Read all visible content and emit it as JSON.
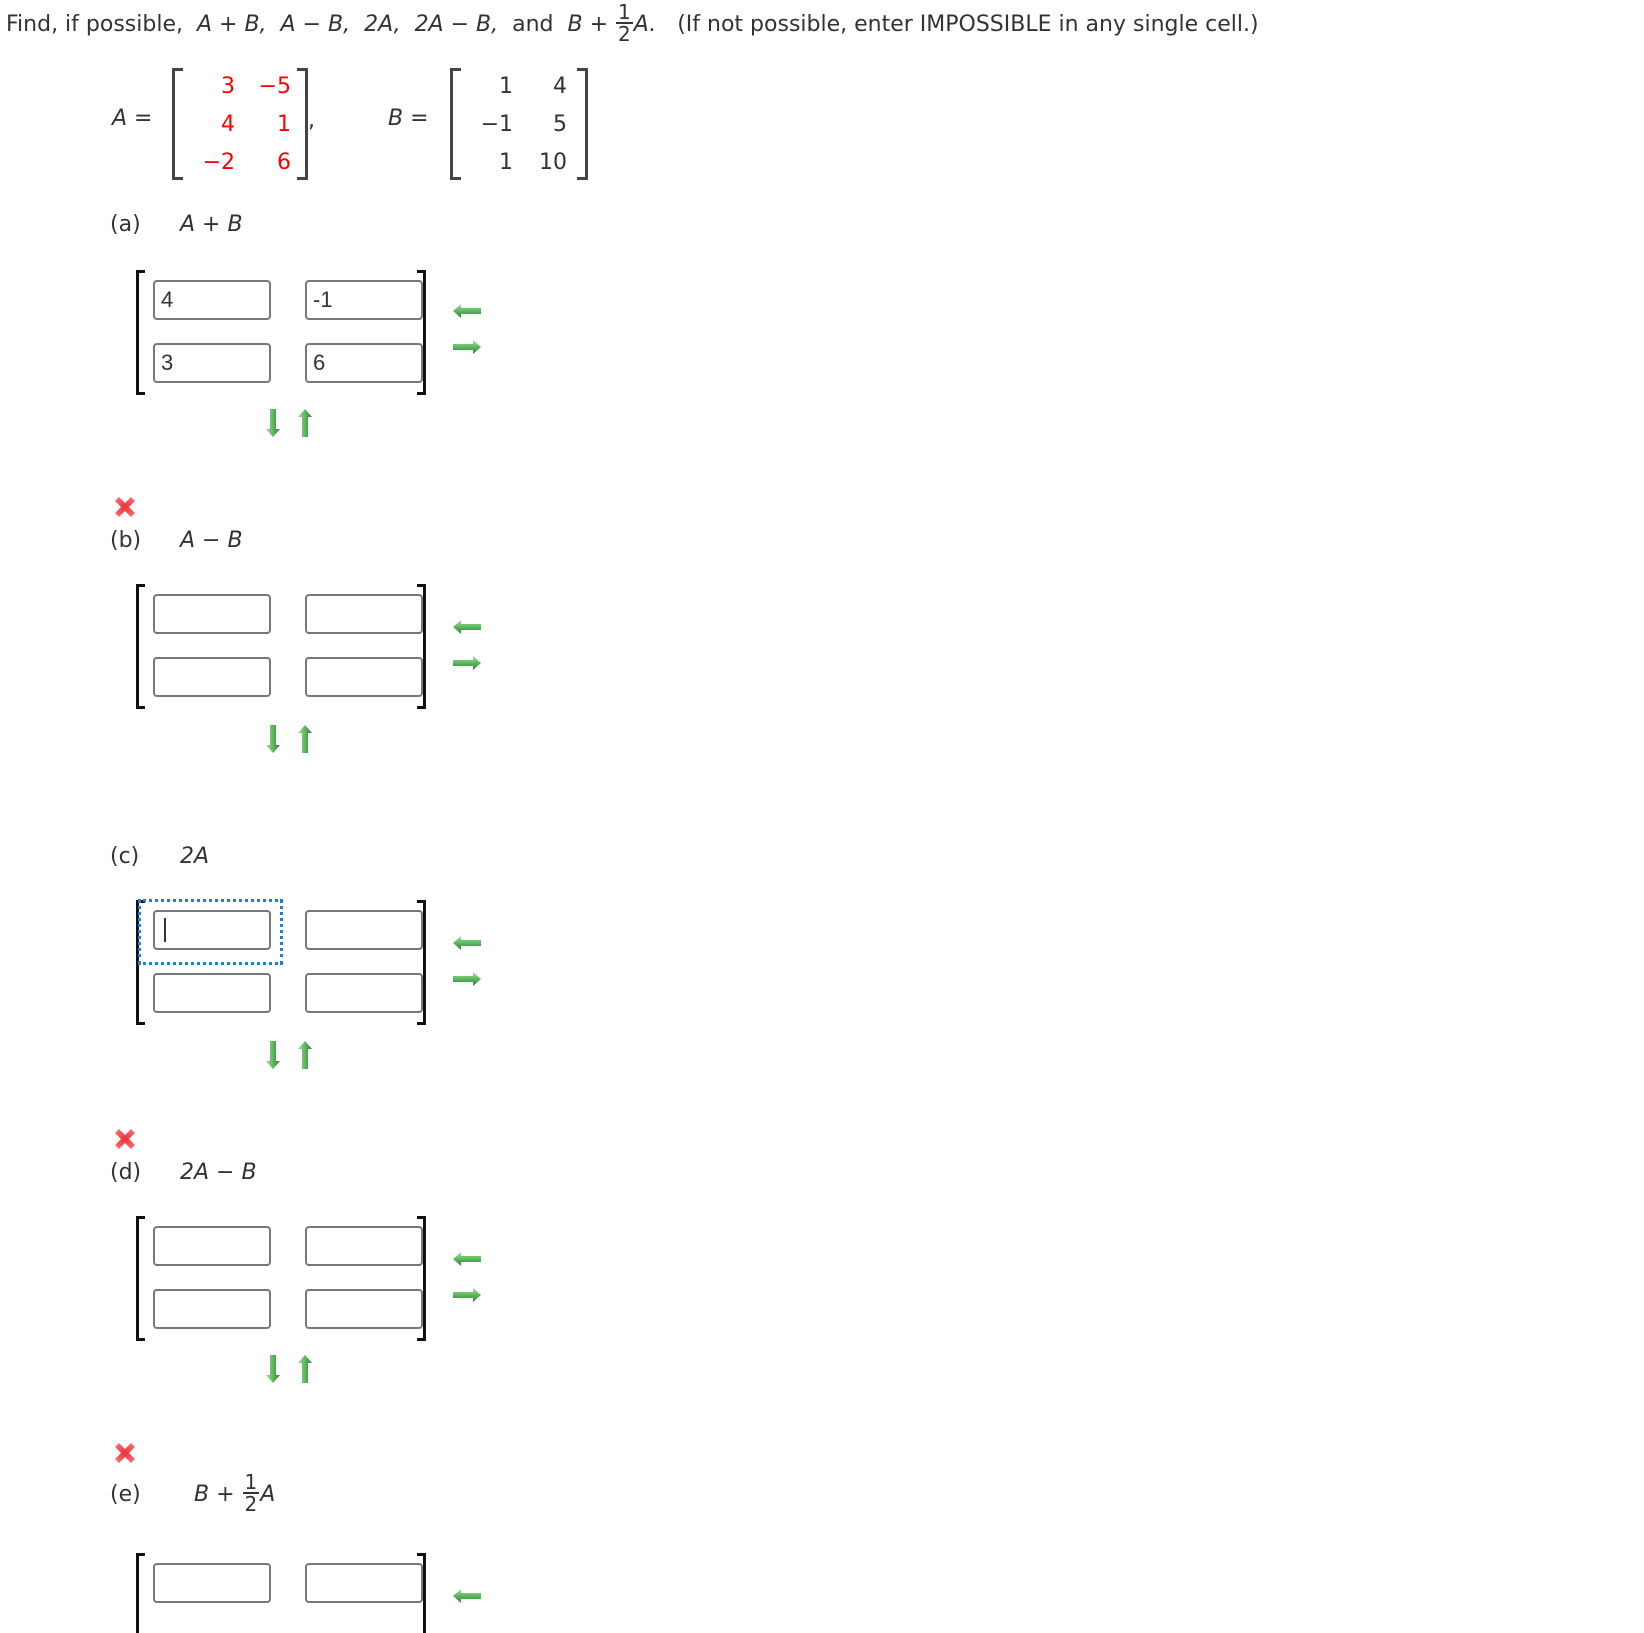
{
  "question": {
    "prefix": "Find, if possible,",
    "expr1": "A + B,",
    "expr2": "A − B,",
    "expr3": "2A,",
    "expr4": "2A − B,",
    "and": "and",
    "expr5_pre": "B +",
    "frac_num": "1",
    "frac_den": "2",
    "expr5_post": "A.",
    "note": "(If not possible, enter IMPOSSIBLE in any single cell.)"
  },
  "given": {
    "A_label": "A =",
    "B_label": "B =",
    "comma": ",",
    "A": [
      [
        "3",
        "−5"
      ],
      [
        "4",
        "1"
      ],
      [
        "−2",
        "6"
      ]
    ],
    "B": [
      [
        "1",
        "4"
      ],
      [
        "−1",
        "5"
      ],
      [
        "1",
        "10"
      ]
    ],
    "A_color": "#ff0000",
    "B_color": "#333333"
  },
  "parts": [
    {
      "letter": "(a)",
      "expression": "A + B",
      "status": "none",
      "cells": [
        [
          "4",
          "-1"
        ],
        [
          "3",
          "6"
        ]
      ],
      "focused_cell": null
    },
    {
      "letter": "(b)",
      "expression": "A − B",
      "status": "incorrect",
      "cells": [
        [
          "",
          ""
        ],
        [
          "",
          ""
        ]
      ],
      "focused_cell": null
    },
    {
      "letter": "(c)",
      "expression": "2A",
      "status": "none",
      "cells": [
        [
          "",
          ""
        ],
        [
          "",
          ""
        ]
      ],
      "focused_cell": [
        0,
        0
      ]
    },
    {
      "letter": "(d)",
      "expression": "2A − B",
      "status": "incorrect",
      "cells": [
        [
          "",
          ""
        ],
        [
          "",
          ""
        ]
      ],
      "focused_cell": null
    },
    {
      "letter": "(e)",
      "expression_pre": "B +",
      "frac_num": "1",
      "frac_den": "2",
      "expression_post": "A",
      "status": "incorrect",
      "cells": [
        [
          "",
          ""
        ]
      ],
      "focused_cell": null
    }
  ],
  "icons": {
    "incorrect": "x-mark-icon",
    "remove_column": "arrow-left-icon",
    "add_column": "arrow-right-icon",
    "add_row": "arrow-down-icon",
    "remove_row": "arrow-up-icon"
  },
  "colors": {
    "incorrect_red": "#f0444f",
    "arrow_green": "#4caf50",
    "focus_blue": "#1a7fe0"
  }
}
